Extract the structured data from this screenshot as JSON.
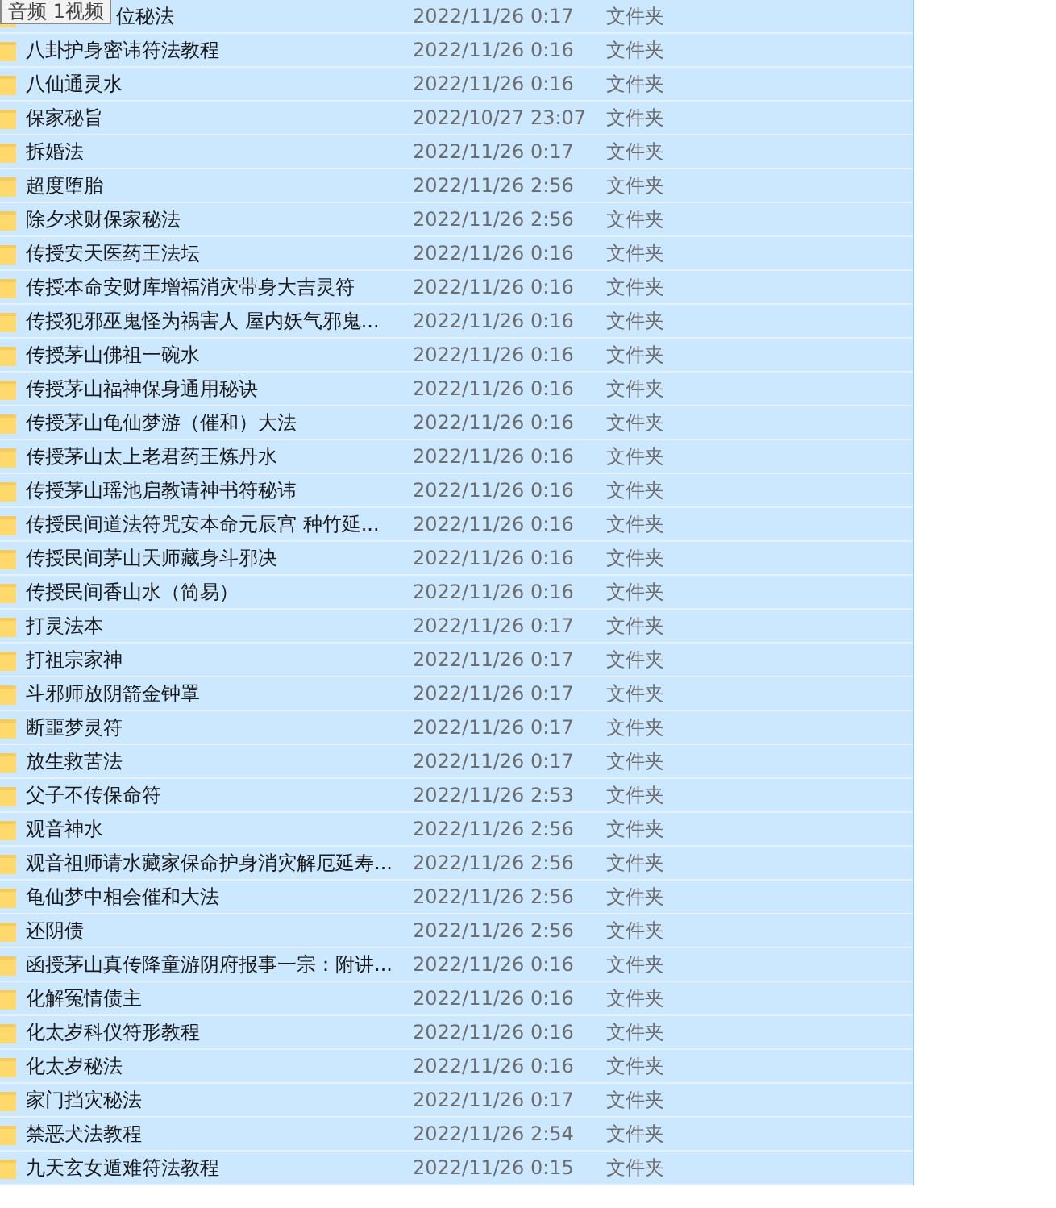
{
  "tooltip": {
    "text": "音频 1视频"
  },
  "rows": [
    {
      "name": "位秘法",
      "date": "2022/11/26 0:17",
      "type": "文件夹",
      "selected": true
    },
    {
      "name": "八卦护身密讳符法教程",
      "date": "2022/11/26 0:16",
      "type": "文件夹",
      "selected": true
    },
    {
      "name": "八仙通灵水",
      "date": "2022/11/26 0:16",
      "type": "文件夹",
      "selected": true
    },
    {
      "name": "保家秘旨",
      "date": "2022/10/27 23:07",
      "type": "文件夹",
      "selected": true
    },
    {
      "name": "拆婚法",
      "date": "2022/11/26 0:17",
      "type": "文件夹",
      "selected": true
    },
    {
      "name": "超度堕胎",
      "date": "2022/11/26 2:56",
      "type": "文件夹",
      "selected": true
    },
    {
      "name": "除夕求财保家秘法",
      "date": "2022/11/26 2:56",
      "type": "文件夹",
      "selected": true
    },
    {
      "name": "传授安天医药王法坛",
      "date": "2022/11/26 0:16",
      "type": "文件夹",
      "selected": true
    },
    {
      "name": "传授本命安财库增福消灾带身大吉灵符",
      "date": "2022/11/26 0:16",
      "type": "文件夹",
      "selected": true
    },
    {
      "name": "传授犯邪巫鬼怪为祸害人 屋内妖气邪鬼...",
      "date": "2022/11/26 0:16",
      "type": "文件夹",
      "selected": true
    },
    {
      "name": "传授茅山佛祖一碗水",
      "date": "2022/11/26 0:16",
      "type": "文件夹",
      "selected": true
    },
    {
      "name": "传授茅山福神保身通用秘诀",
      "date": "2022/11/26 0:16",
      "type": "文件夹",
      "selected": true
    },
    {
      "name": "传授茅山龟仙梦游（催和）大法",
      "date": "2022/11/26 0:16",
      "type": "文件夹",
      "selected": true
    },
    {
      "name": "传授茅山太上老君药王炼丹水",
      "date": "2022/11/26 0:16",
      "type": "文件夹",
      "selected": true
    },
    {
      "name": "传授茅山瑶池启教请神书符秘讳",
      "date": "2022/11/26 0:16",
      "type": "文件夹",
      "selected": true
    },
    {
      "name": "传授民间道法符咒安本命元辰宫 种竹延...",
      "date": "2022/11/26 0:16",
      "type": "文件夹",
      "selected": true
    },
    {
      "name": "传授民间茅山天师藏身斗邪决",
      "date": "2022/11/26 0:16",
      "type": "文件夹",
      "selected": true
    },
    {
      "name": "传授民间香山水（简易）",
      "date": "2022/11/26 0:16",
      "type": "文件夹",
      "selected": true
    },
    {
      "name": "打灵法本",
      "date": "2022/11/26 0:17",
      "type": "文件夹",
      "selected": true
    },
    {
      "name": "打祖宗家神",
      "date": "2022/11/26 0:17",
      "type": "文件夹",
      "selected": true
    },
    {
      "name": "斗邪师放阴箭金钟罩",
      "date": "2022/11/26 0:17",
      "type": "文件夹",
      "selected": true
    },
    {
      "name": "断噩梦灵符",
      "date": "2022/11/26 0:17",
      "type": "文件夹",
      "selected": true
    },
    {
      "name": "放生救苦法",
      "date": "2022/11/26 0:17",
      "type": "文件夹",
      "selected": true
    },
    {
      "name": "父子不传保命符",
      "date": "2022/11/26 2:53",
      "type": "文件夹",
      "selected": true
    },
    {
      "name": "观音神水",
      "date": "2022/11/26 2:56",
      "type": "文件夹",
      "selected": true
    },
    {
      "name": "观音祖师请水藏家保命护身消灾解厄延寿...",
      "date": "2022/11/26 2:56",
      "type": "文件夹",
      "selected": true
    },
    {
      "name": "龟仙梦中相会催和大法",
      "date": "2022/11/26 2:56",
      "type": "文件夹",
      "selected": true
    },
    {
      "name": "还阴债",
      "date": "2022/11/26 2:56",
      "type": "文件夹",
      "selected": true
    },
    {
      "name": "函授茅山真传降童游阴府报事一宗：附讲...",
      "date": "2022/11/26 0:16",
      "type": "文件夹",
      "selected": true
    },
    {
      "name": "化解冤情债主",
      "date": "2022/11/26 0:16",
      "type": "文件夹",
      "selected": true
    },
    {
      "name": "化太岁科仪符形教程",
      "date": "2022/11/26 0:16",
      "type": "文件夹",
      "selected": true
    },
    {
      "name": "化太岁秘法",
      "date": "2022/11/26 0:16",
      "type": "文件夹",
      "selected": true
    },
    {
      "name": "家门挡灾秘法",
      "date": "2022/11/26 0:17",
      "type": "文件夹",
      "selected": true
    },
    {
      "name": "禁恶犬法教程",
      "date": "2022/11/26 2:54",
      "type": "文件夹",
      "selected": true
    },
    {
      "name": "九天玄女遁难符法教程",
      "date": "2022/11/26 0:15",
      "type": "文件夹",
      "selected": true
    }
  ]
}
